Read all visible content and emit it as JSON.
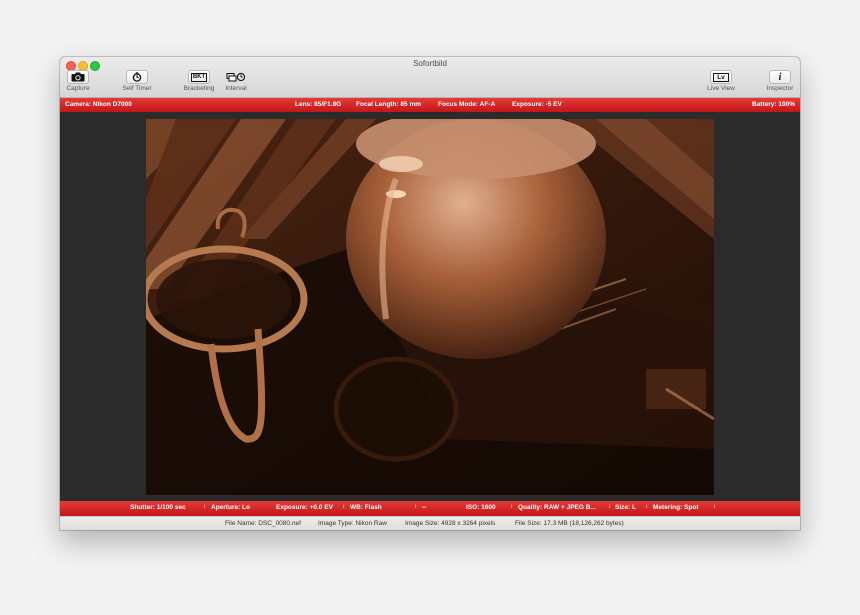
{
  "window": {
    "title": "Sofortbild"
  },
  "toolbar": {
    "capture": "Capture",
    "self_timer": "Self Timer",
    "bracketing": "Bracketing",
    "bracketing_glyph": "BKT",
    "interval": "Interval",
    "live_view": "Live View",
    "live_view_glyph": "Lv",
    "inspector": "Inspector",
    "inspector_glyph": "i"
  },
  "info_bar": {
    "camera": "Camera: Nikon D7000",
    "lens": "Lens: 85/F1.8G",
    "focal_length": "Focal Length: 85 mm",
    "focus_mode": "Focus Mode: AF-A",
    "exposure": "Exposure: -5 EV",
    "battery": "Battery: 100%"
  },
  "settings": {
    "shutter": "Shutter: 1/100 sec",
    "aperture": "Aperture: Lo",
    "exposure_comp": "Exposure: +0.0 EV",
    "wb": "WB: Flash",
    "wb_extra": "--",
    "iso": "ISO: 1600",
    "quality": "Quality: RAW + JPEG B...",
    "size": "Size: L",
    "metering": "Metering: Spot",
    "stepper_glyph": "↕"
  },
  "status": {
    "file_name": "File Name: DSC_0080.nef",
    "image_type": "Image Type: Nikon Raw",
    "image_size": "Image Size: 4928 x 3264 pixels",
    "file_size": "File Size: 17.3 MB (18,126,262 bytes)"
  }
}
